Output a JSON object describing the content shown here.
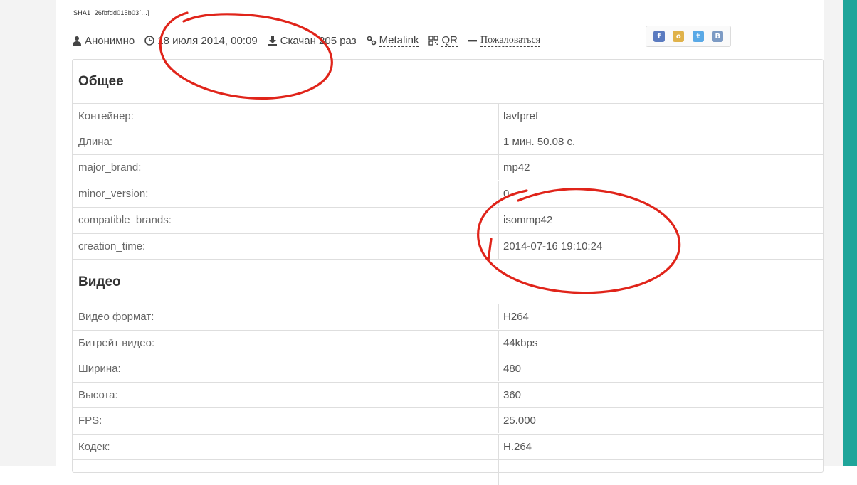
{
  "sha": {
    "label": "SHA1",
    "hash": "26fbfdd015b03[…]"
  },
  "meta": {
    "author": "Анонимно",
    "date": "18 июля 2014, 00:09",
    "downloads": "Скачан 205 раз",
    "metalink": "Metalink",
    "qr": "QR",
    "complain": "Пожаловаться"
  },
  "social": [
    "f",
    "o",
    "t",
    "B"
  ],
  "general": {
    "title": "Общее",
    "rows": [
      {
        "key": "Контейнер:",
        "value": "lavfpref"
      },
      {
        "key": "Длина:",
        "value": "1 мин. 50.08 с."
      },
      {
        "key": "major_brand:",
        "value": "mp42"
      },
      {
        "key": "minor_version:",
        "value": "0"
      },
      {
        "key": "compatible_brands:",
        "value": "isommp42"
      },
      {
        "key": "creation_time:",
        "value": "2014-07-16 19:10:24"
      }
    ]
  },
  "video": {
    "title": "Видео",
    "rows": [
      {
        "key": "Видео формат:",
        "value": "H264"
      },
      {
        "key": "Битрейт видео:",
        "value": "44kbps"
      },
      {
        "key": "Ширина:",
        "value": "480"
      },
      {
        "key": "Высота:",
        "value": "360"
      },
      {
        "key": "FPS:",
        "value": "25.000"
      },
      {
        "key": "Кодек:",
        "value": "H.264"
      }
    ]
  },
  "colors": {
    "annotation": "#e0241a",
    "frame_accent": "#1fa59a"
  }
}
